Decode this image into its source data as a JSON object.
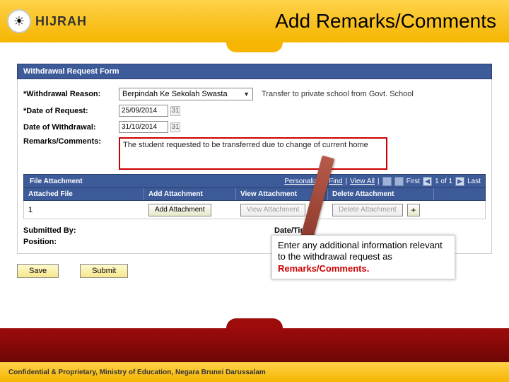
{
  "header": {
    "logo_text": "HIJRAH",
    "title": "Add Remarks/Comments"
  },
  "section": {
    "title": "Withdrawal Request Form"
  },
  "form": {
    "reason_label": "*Withdrawal Reason:",
    "reason_value": "Berpindah Ke Sekolah Swasta",
    "reason_side": "Transfer to private school from Govt. School",
    "request_date_label": "*Date of Request:",
    "request_date_value": "25/09/2014",
    "withdraw_date_label": "Date of Withdrawal:",
    "withdraw_date_value": "31/10/2014",
    "remarks_label": "Remarks/Comments:",
    "remarks_value": "The student requested to be transferred due to change of current home",
    "submitted_label": "Submitted By:",
    "datetime_label": "Date/Time:",
    "position_label": "Position:"
  },
  "grid": {
    "title": "File Attachment",
    "personalize": "Personalize",
    "find": "Find",
    "viewall": "View All",
    "first": "First",
    "counter": "1 of 1",
    "last": "Last",
    "col_file": "Attached File",
    "col_add": "Add Attachment",
    "col_view": "View Attachment",
    "col_delete": "Delete Attachment",
    "row_num": "1",
    "btn_add": "Add Attachment",
    "btn_view": "View Attachment",
    "btn_delete": "Delete Attachment"
  },
  "actions": {
    "save": "Save",
    "submit": "Submit"
  },
  "callout": {
    "line1": "Enter any additional information relevant to the withdrawal request as ",
    "highlight": "Remarks/Comments."
  },
  "footer": {
    "text": "Confidential & Proprietary, Ministry of Education, Negara Brunei Darussalam"
  }
}
